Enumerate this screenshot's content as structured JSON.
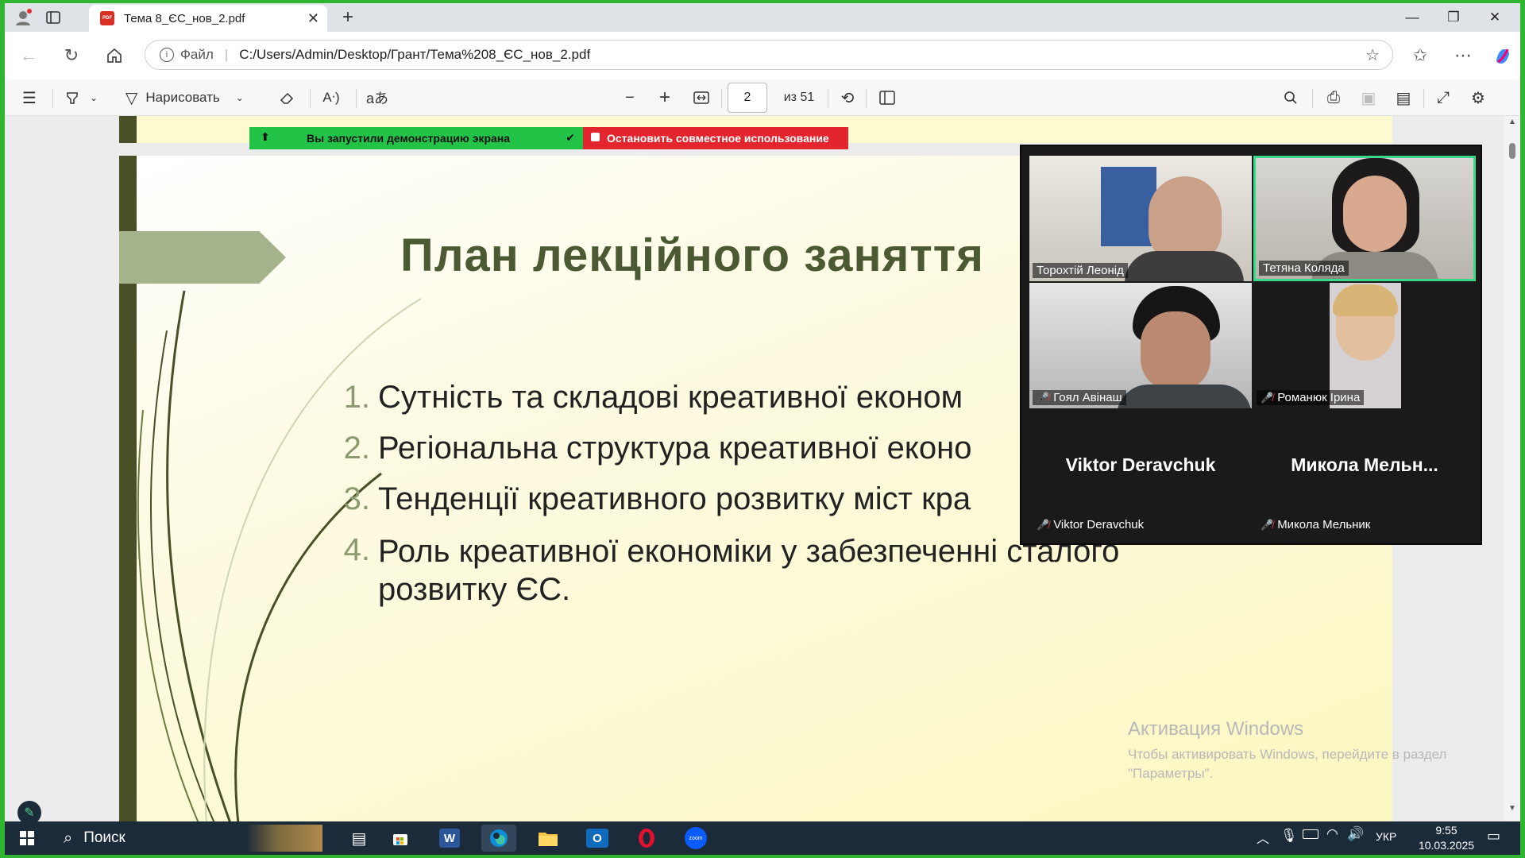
{
  "browser": {
    "tab_title": "Тема 8_ЄС_нов_2.pdf",
    "address_prefix": "Файл",
    "address": "C:/Users/Admin/Desktop/Грант/Тема%208_ЄС_нов_2.pdf"
  },
  "pdf_toolbar": {
    "draw_label": "Нарисовать",
    "page_current": "2",
    "page_total": "из 51"
  },
  "slide": {
    "title": "План лекційного заняття",
    "items": [
      {
        "num": "1.",
        "text": "Сутність та складові креативної економ"
      },
      {
        "num": "2.",
        "text": "Регіональна структура креативної еконо"
      },
      {
        "num": "3.",
        "text": "Тенденції креативного розвитку міст кра"
      },
      {
        "num": "4.",
        "text": "Роль креативної економіки у забезпеченні сталого",
        "text2": "розвитку ЄС."
      }
    ]
  },
  "share": {
    "active_text": "Вы запустили демонстрацию экрана",
    "stop_text": "Остановить совместное использование"
  },
  "zoom": {
    "participants": [
      {
        "name": "Торохтій Леонід",
        "muted": false
      },
      {
        "name": "Тетяна Коляда",
        "muted": false
      },
      {
        "name": "Гоял Авінаш",
        "muted": true
      },
      {
        "name": "Романюк Ірина",
        "muted": true
      },
      {
        "name": "Viktor Deravchuk",
        "muted": true,
        "display": "Viktor Deravchuk"
      },
      {
        "name": "Микола Мельник",
        "muted": true,
        "display": "Микола  Мельн..."
      }
    ]
  },
  "watermark": {
    "title": "Активация Windows",
    "line1": "Чтобы активировать Windows, перейдите в раздел",
    "line2": "\"Параметры\"."
  },
  "taskbar": {
    "search_label": "Поиск",
    "lang": "УКР",
    "time": "9:55",
    "date": "10.03.2025"
  },
  "colors": {
    "accent_green": "#2fb52f",
    "slide_title": "#4c5a34",
    "slide_bar": "#495027"
  }
}
